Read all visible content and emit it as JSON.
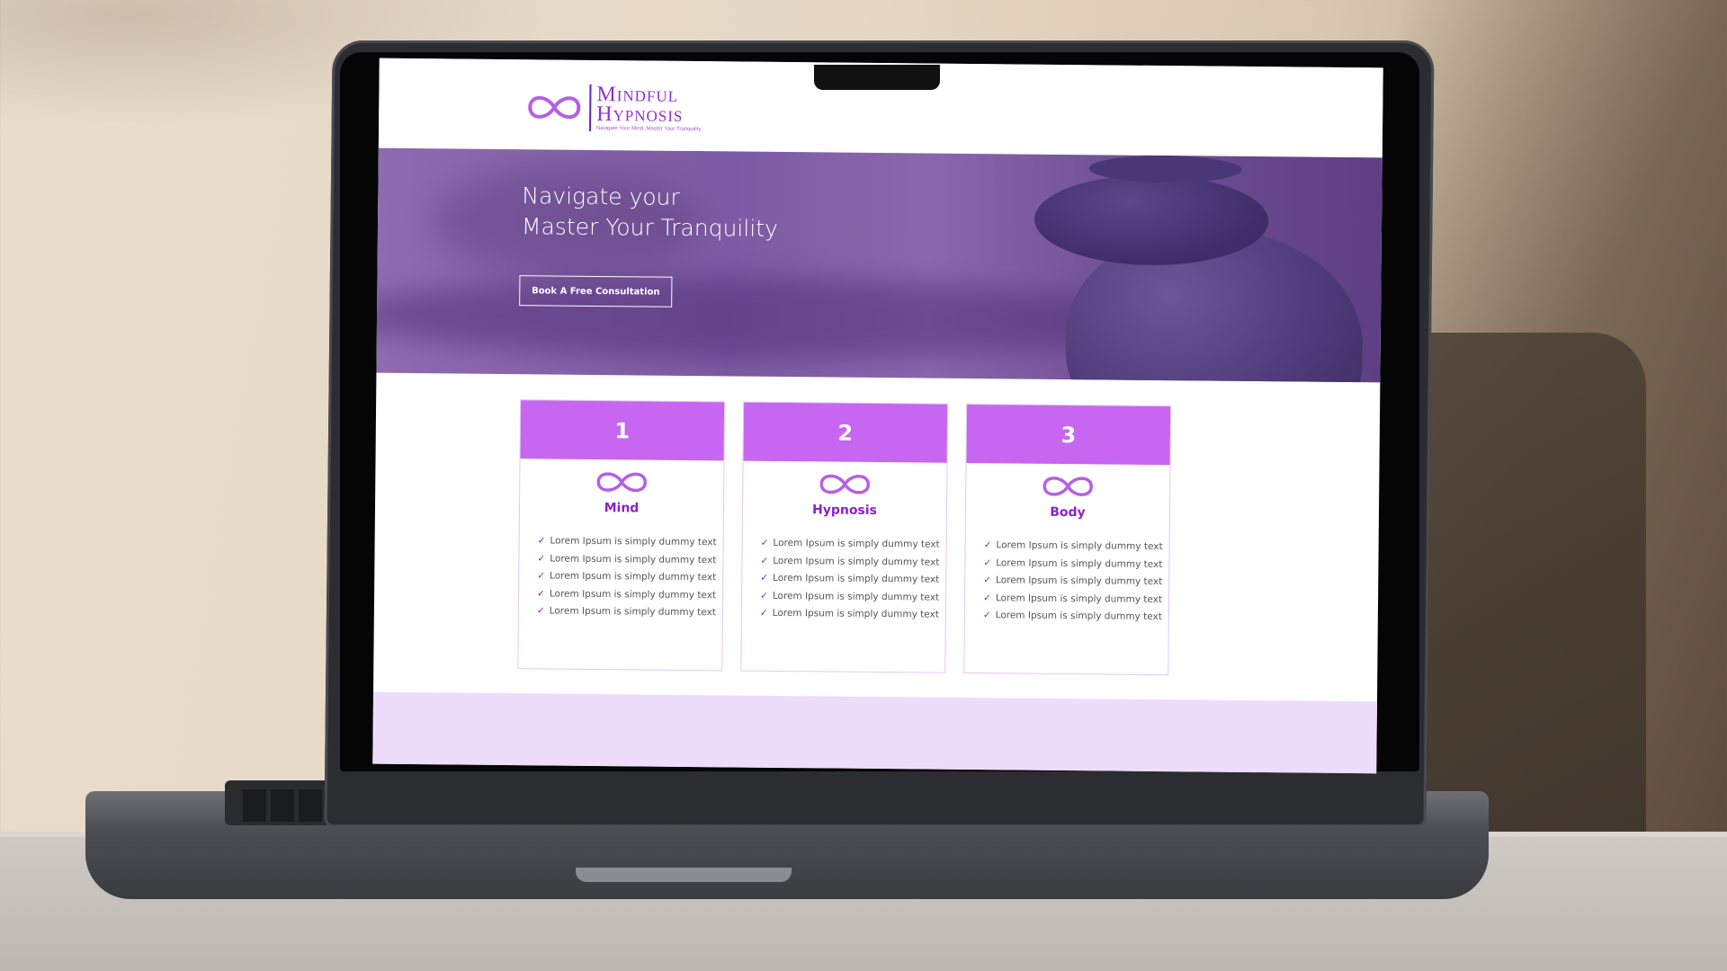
{
  "scene": {
    "wall_color": "#e6d8c5",
    "table_color": "#c5c0ba",
    "device": "laptop"
  },
  "site": {
    "logo": {
      "title_line1": "Mindful",
      "title_line2": "Hypnosis",
      "tagline": "Navigate Your Mind, Master Your Tranquility",
      "icon": "infinity-icon"
    },
    "hero": {
      "title_line1": "Navigate your",
      "title_line2": "Master Your Tranquility",
      "cta_label": "Book A Free Consultation"
    },
    "cards": [
      {
        "number": "1",
        "title": "Mind",
        "icon": "infinity-icon",
        "items": [
          "Lorem Ipsum is simply dummy text",
          "Lorem Ipsum is simply dummy text",
          "Lorem Ipsum is simply dummy text",
          "Lorem Ipsum is simply dummy text",
          "Lorem Ipsum is simply dummy text"
        ]
      },
      {
        "number": "2",
        "title": "Hypnosis",
        "icon": "infinity-icon",
        "items": [
          "Lorem Ipsum is simply dummy text",
          "Lorem Ipsum is simply dummy text",
          "Lorem Ipsum is simply dummy text",
          "Lorem Ipsum is simply dummy text",
          "Lorem Ipsum is simply dummy text"
        ]
      },
      {
        "number": "3",
        "title": "Body",
        "icon": "infinity-icon",
        "items": [
          "Lorem Ipsum is simply dummy text",
          "Lorem Ipsum is simply dummy text",
          "Lorem Ipsum is simply dummy text",
          "Lorem Ipsum is simply dummy text",
          "Lorem Ipsum is simply dummy text"
        ]
      }
    ],
    "colors": {
      "accent": "#c766f0",
      "brand": "#8a22c9",
      "hero": "#7d5aa3",
      "band": "#eedcfb"
    }
  }
}
